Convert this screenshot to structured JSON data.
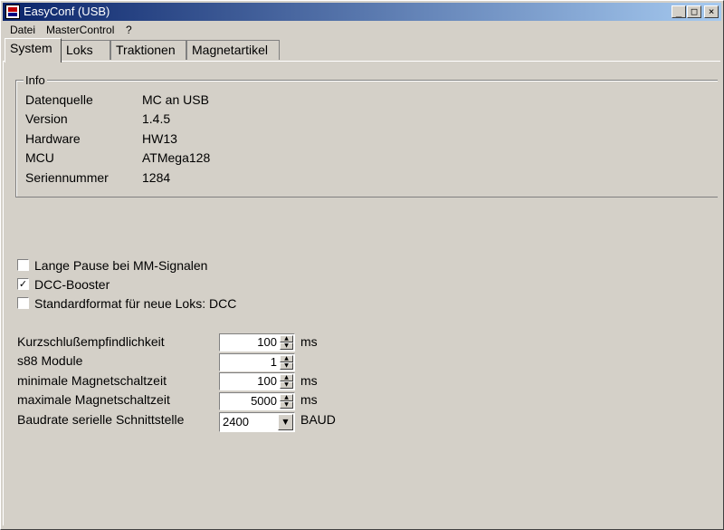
{
  "window": {
    "title": "EasyConf (USB)",
    "minimize": "_",
    "maximize": "□",
    "close": "×"
  },
  "menu": [
    "Datei",
    "MasterControl",
    "?"
  ],
  "tabs": [
    {
      "label": "System",
      "active": true
    },
    {
      "label": "Loks",
      "active": false
    },
    {
      "label": "Traktionen",
      "active": false
    },
    {
      "label": "Magnetartikel",
      "active": false
    }
  ],
  "info": {
    "legend": "Info",
    "rows": [
      {
        "label": "Datenquelle",
        "value": "MC an USB"
      },
      {
        "label": "Version",
        "value": "1.4.5"
      },
      {
        "label": "Hardware",
        "value": "HW13"
      },
      {
        "label": "MCU",
        "value": "ATMega128"
      },
      {
        "label": "Seriennummer",
        "value": "1284"
      }
    ]
  },
  "checkboxes": [
    {
      "label": "Lange Pause bei MM-Signalen",
      "checked": false,
      "mark": ""
    },
    {
      "label": "DCC-Booster",
      "checked": true,
      "mark": "✓"
    },
    {
      "label": "Standardformat für neue Loks: DCC",
      "checked": false,
      "mark": ""
    }
  ],
  "settings": [
    {
      "label": "Kurzschlußempfindlichkeit",
      "value": "100",
      "unit": "ms"
    },
    {
      "label": "s88 Module",
      "value": "1",
      "unit": ""
    },
    {
      "label": "minimale Magnetschaltzeit",
      "value": "100",
      "unit": "ms"
    },
    {
      "label": "maximale Magnetschaltzeit",
      "value": "5000",
      "unit": "ms"
    }
  ],
  "baud": {
    "label": "Baudrate serielle Schnittstelle",
    "value": "2400",
    "unit": "BAUD"
  },
  "icons": {
    "up": "▲",
    "down": "▼",
    "dropdown": "▼"
  }
}
